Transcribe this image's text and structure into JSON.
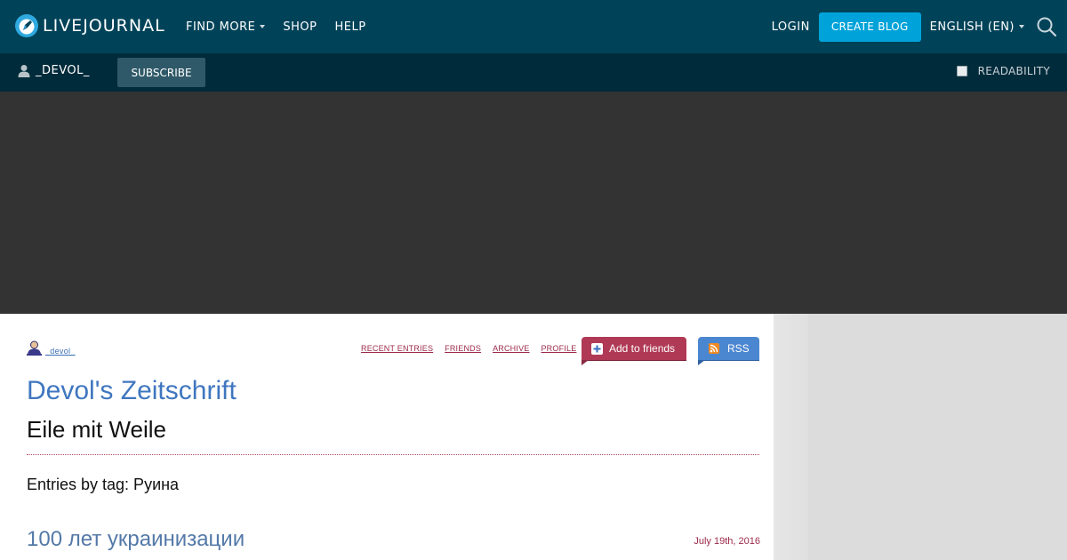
{
  "header": {
    "logo_text": "LIVEJOURNAL",
    "nav": [
      {
        "label": "FIND MORE",
        "has_dropdown": true
      },
      {
        "label": "SHOP",
        "has_dropdown": false
      },
      {
        "label": "HELP",
        "has_dropdown": false
      }
    ],
    "login_label": "LOGIN",
    "create_blog_label": "CREATE BLOG",
    "language_label": "ENGLISH (EN)",
    "search_icon": "search-icon",
    "colors": {
      "bar": "#004359",
      "accent": "#00a3d9"
    }
  },
  "subheader": {
    "username": "_DEVOL_",
    "subscribe_label": "SUBSCRIBE",
    "readability_label": "READABILITY",
    "readability_checked": false,
    "user_icon": "user-icon"
  },
  "journal": {
    "owner_link": "_devol_",
    "nav_links": [
      "RECENT ENTRIES",
      "FRIENDS",
      "ARCHIVE",
      "PROFILE"
    ],
    "add_friends_label": "Add to friends",
    "rss_label": "RSS",
    "title": "Devol's Zeitschrift",
    "subtitle": "Eile mit Weile",
    "tag_heading": "Entries by tag: Руина",
    "colors": {
      "title": "#3f76bf",
      "links": "#9c2a4a",
      "add_friends": "#b03a55",
      "rss": "#4b87d0"
    }
  },
  "entries": [
    {
      "title": "100 лет украинизации",
      "date": "July 19th, 2016"
    }
  ]
}
